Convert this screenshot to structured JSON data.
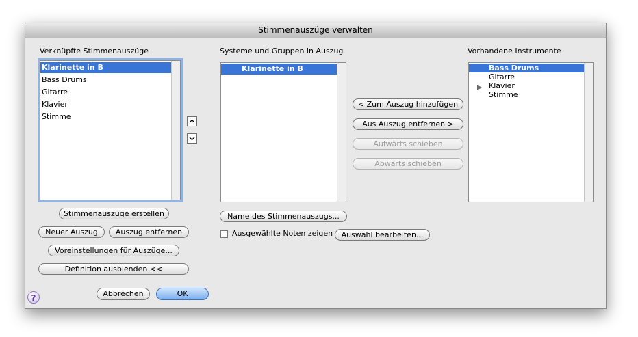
{
  "window": {
    "title": "Stimmenauszüge verwalten"
  },
  "left": {
    "heading": "Verknüpfte Stimmenauszüge",
    "items": [
      "Klarinette in B",
      "Bass Drums",
      "Gitarre",
      "Klavier",
      "Stimme"
    ],
    "buttons": {
      "create": "Stimmenauszüge erstellen",
      "new": "Neuer Auszug",
      "remove": "Auszug entfernen",
      "prefs": "Voreinstellungen für Auszüge...",
      "hide_def": "Definition ausblenden <<"
    },
    "move_up_icon": "chevron-up-icon",
    "move_down_icon": "chevron-down-icon"
  },
  "middle": {
    "heading": "Systeme und Gruppen in Auszug",
    "items": [
      "Klarinette in B"
    ],
    "name_button": "Name des Stimmenauszugs...",
    "show_selected_label": "Ausgewählte Noten zeigen",
    "edit_selection_button": "Auswahl bearbeiten..."
  },
  "actions": {
    "add": "< Zum Auszug hinzufügen",
    "remove": "Aus Auszug entfernen >",
    "up": "Aufwärts schieben",
    "down": "Abwärts schieben"
  },
  "right": {
    "heading": "Vorhandene Instrumente",
    "items": [
      "Bass Drums",
      "Gitarre",
      "Klavier",
      "Stimme"
    ]
  },
  "footer": {
    "cancel": "Abbrechen",
    "ok": "OK",
    "help_icon": "help-icon",
    "help_glyph": "?"
  }
}
